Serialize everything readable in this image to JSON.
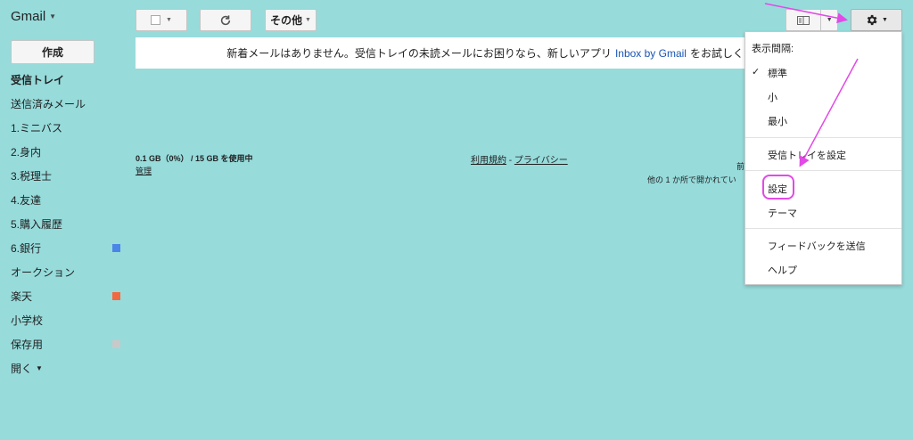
{
  "app": {
    "brand": "Gmail"
  },
  "compose": {
    "label": "作成"
  },
  "nav": {
    "items": [
      {
        "label": "受信トレイ",
        "active": true
      },
      {
        "label": "送信済みメール"
      },
      {
        "label": "1.ミニバス"
      },
      {
        "label": "2.身内"
      },
      {
        "label": "3.税理士"
      },
      {
        "label": "4.友達"
      },
      {
        "label": "5.購入履歴"
      },
      {
        "label": "6.銀行",
        "color": "#4a86e8"
      },
      {
        "label": "オークション"
      },
      {
        "label": "楽天",
        "color": "#f2693f"
      },
      {
        "label": "小学校"
      },
      {
        "label": "保存用",
        "color": "#c9c9c9"
      }
    ],
    "more_label": "開く"
  },
  "toolbar": {
    "more_label": "その他",
    "icons": [
      "checkbox-icon",
      "refresh-icon",
      "density-icon",
      "gear-icon"
    ]
  },
  "notice": {
    "text": "新着メールはありません。受信トレイの未読メールにお困りなら、新しいアプリ",
    "link": "Inbox by Gmail",
    "suffix": "をお試しく"
  },
  "footer": {
    "storage": "0.1 GB（0%） / 15 GB を使用中",
    "manage": "管理",
    "terms": "利用規約",
    "separator": " - ",
    "privacy": "プライバシー",
    "activity_line1": "前",
    "activity_line2": "他の 1 か所で開かれてい"
  },
  "settings_menu": {
    "heading": "表示間隔:",
    "density": [
      {
        "label": "標準",
        "checked": true
      },
      {
        "label": "小"
      },
      {
        "label": "最小"
      }
    ],
    "inbox_settings": "受信トレイを設定",
    "settings": "設定",
    "themes": "テーマ",
    "feedback": "フィードバックを送信",
    "help": "ヘルプ"
  },
  "colors": {
    "background": "#97dbdb",
    "annotation": "#e24ae6",
    "link": "#1a55b4"
  }
}
